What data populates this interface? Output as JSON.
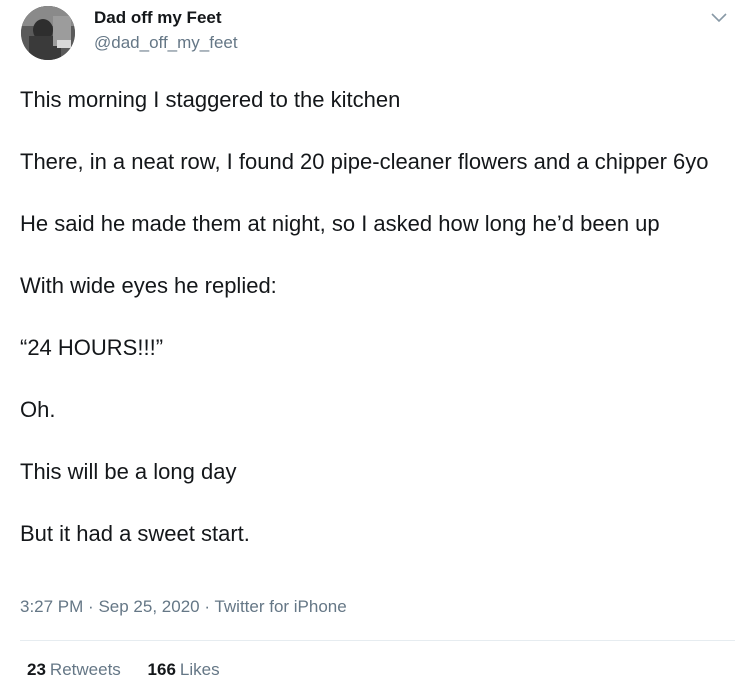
{
  "tweet": {
    "author": {
      "display_name": "Dad off my Feet",
      "handle": "@dad_off_my_feet"
    },
    "menu_icon": "chevron-down-icon",
    "paragraphs": [
      "This morning I staggered to the kitchen",
      "There, in a neat row, I found 20 pipe-cleaner flowers and a chipper 6yo",
      "He said he made them at night, so I asked how long he’d been up",
      "With wide eyes he replied:",
      "“24 HOURS!!!”",
      "Oh.",
      "This will be a long day",
      "But it had a sweet start."
    ],
    "meta": {
      "time": "3:27 PM",
      "separator": "·",
      "date": "Sep 25, 2020",
      "source": "Twitter for iPhone"
    },
    "stats": {
      "retweets_count": "23",
      "retweets_label": "Retweets",
      "likes_count": "166",
      "likes_label": "Likes"
    }
  },
  "colors": {
    "text_primary": "#14171a",
    "text_secondary": "#657786",
    "divider": "#e6ecf0"
  }
}
